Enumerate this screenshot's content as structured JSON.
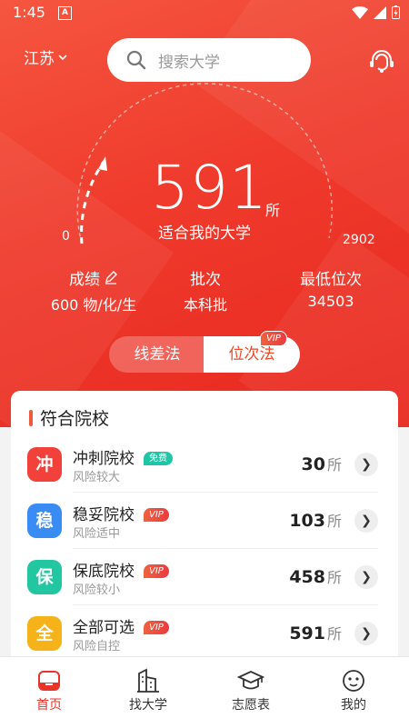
{
  "status": {
    "time": "1:45",
    "a_icon": "A"
  },
  "header": {
    "province": "江苏",
    "search_placeholder": "搜索大学"
  },
  "gauge": {
    "count": "591",
    "unit": "所",
    "label": "适合我的大学",
    "min": "0",
    "max": "2902",
    "fill_fraction": 0.2
  },
  "stats": [
    {
      "key": "成绩",
      "value": "600 物/化/生",
      "editable": true
    },
    {
      "key": "批次",
      "value": "本科批"
    },
    {
      "key": "最低位次",
      "value": "34503"
    }
  ],
  "method_toggle": {
    "left": "线差法",
    "right": "位次法",
    "right_tag": "VIP",
    "selected": "位次法"
  },
  "card": {
    "title": "符合院校",
    "rows": [
      {
        "badge": "冲",
        "badge_color": "#f2413b",
        "name": "冲刺院校",
        "tag": "免费",
        "tag_type": "free",
        "sub": "风险较大",
        "count": "30",
        "unit": "所"
      },
      {
        "badge": "稳",
        "badge_color": "#3a8cf5",
        "name": "稳妥院校",
        "tag": "VIP",
        "tag_type": "vip",
        "sub": "风险适中",
        "count": "103",
        "unit": "所"
      },
      {
        "badge": "保",
        "badge_color": "#22c6a0",
        "name": "保底院校",
        "tag": "VIP",
        "tag_type": "vip",
        "sub": "风险较小",
        "count": "458",
        "unit": "所"
      },
      {
        "badge": "全",
        "badge_color": "#f6b319",
        "name": "全部可选",
        "tag": "VIP",
        "tag_type": "vip",
        "sub": "风险自控",
        "count": "591",
        "unit": "所"
      }
    ]
  },
  "tabbar": [
    {
      "label": "首页",
      "icon": "home-icon",
      "active": true
    },
    {
      "label": "找大学",
      "icon": "building-icon"
    },
    {
      "label": "志愿表",
      "icon": "graduation-cap-icon"
    },
    {
      "label": "我的",
      "icon": "smile-icon"
    }
  ],
  "colors": {
    "primary": "#e8342a",
    "accent": "#ee5a3a"
  }
}
